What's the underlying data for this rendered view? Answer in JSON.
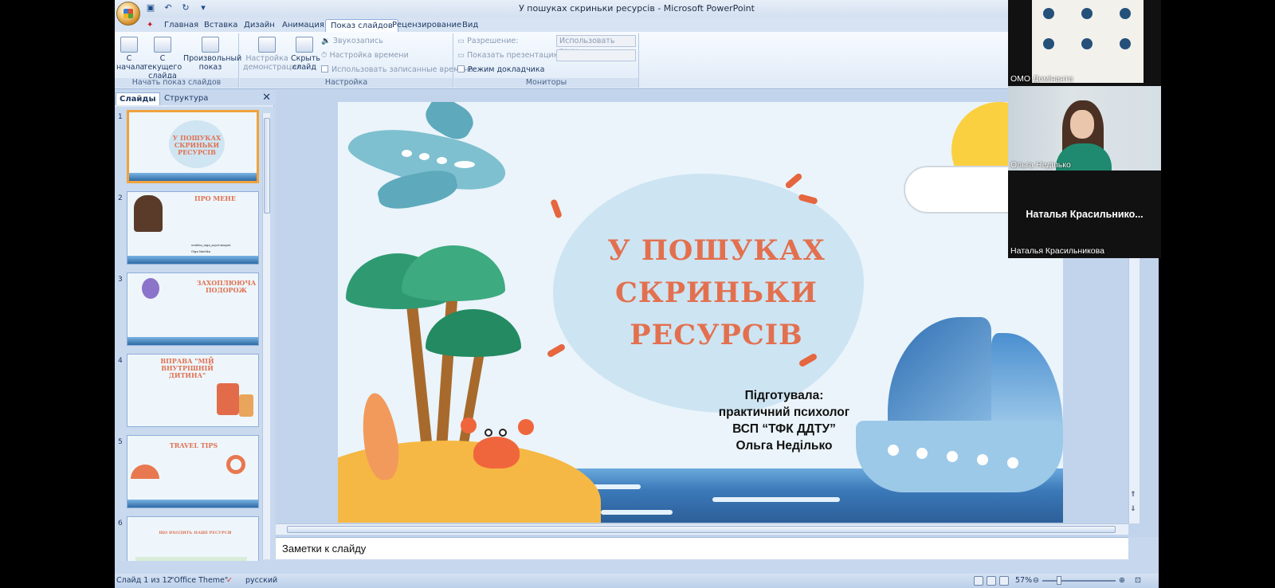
{
  "window": {
    "title": "У пошуках скриньки ресурсів - Microsoft PowerPoint"
  },
  "qat": [
    "save-icon",
    "undo-icon",
    "redo-icon",
    "customize-icon"
  ],
  "tabs": [
    "Главная",
    "Вставка",
    "Дизайн",
    "Анимация",
    "Показ слайдов",
    "Рецензирование",
    "Вид"
  ],
  "ribbon": {
    "start": {
      "from_start": "С начала",
      "from_current": "С текущего слайда",
      "custom": "Произвольный показ",
      "label": "Начать показ слайдов"
    },
    "setup": {
      "setup_show": "Настройка демонстрации",
      "hide_slide": "Скрыть слайд",
      "record": "Звукозапись",
      "rehearse": "Настройка времени",
      "use_timings": "Использовать записанные времена",
      "label": "Настройка"
    },
    "monitors": {
      "resolution": "Разрешение:",
      "resolution_value": "Использовать теку...",
      "show_on": "Показать презентацию на:",
      "presenter_view": "Режим докладчика",
      "label": "Мониторы"
    }
  },
  "pane": {
    "tab_slides": "Слайды",
    "tab_outline": "Структура"
  },
  "thumbnails": [
    {
      "num": "1",
      "title": "У ПОШУКАХ СКРИНЬКИ РЕСУРСІВ"
    },
    {
      "num": "2",
      "title": "ПРО МЕНЕ",
      "line1": "nedilko_olga_psychologist",
      "line2": "Olga Nedilko"
    },
    {
      "num": "3",
      "title": "ЗАХОПЛЮЮЧА ПОДОРОЖ"
    },
    {
      "num": "4",
      "title": "ВПРАВА \"МІЙ ВНУТРІШНІЙ ДИТИНА\""
    },
    {
      "num": "5",
      "title": "TRAVEL TIPS"
    },
    {
      "num": "6",
      "title": "ЩО ВХОДИТЬ НАШІ РЕСУРСИ"
    }
  ],
  "slide": {
    "title_lines": [
      "У ПОШУКАХ",
      "СКРИНЬКИ",
      "РЕСУРСІВ"
    ],
    "credit_lines": [
      "Підготувала:",
      "практичний психолог",
      "ВСП “ТФК ДДТУ”",
      "Ольга Неділько"
    ]
  },
  "notes": {
    "placeholder": "Заметки к слайду"
  },
  "status": {
    "slide_of": "Слайд 1 из 12",
    "theme": "\"Office Theme\"",
    "language": "русский",
    "zoom": "57%"
  },
  "video": {
    "tile1_name": "ОМО Домінанта",
    "tile2_name": "Ольга Неділько",
    "tile3_big": "Наталья  Красильнико...",
    "tile3_name": "Наталья Красильникова"
  },
  "colors": {
    "accent": "#e2704f",
    "ribbon": "#dfeaf7",
    "selection": "#f0a33c"
  }
}
